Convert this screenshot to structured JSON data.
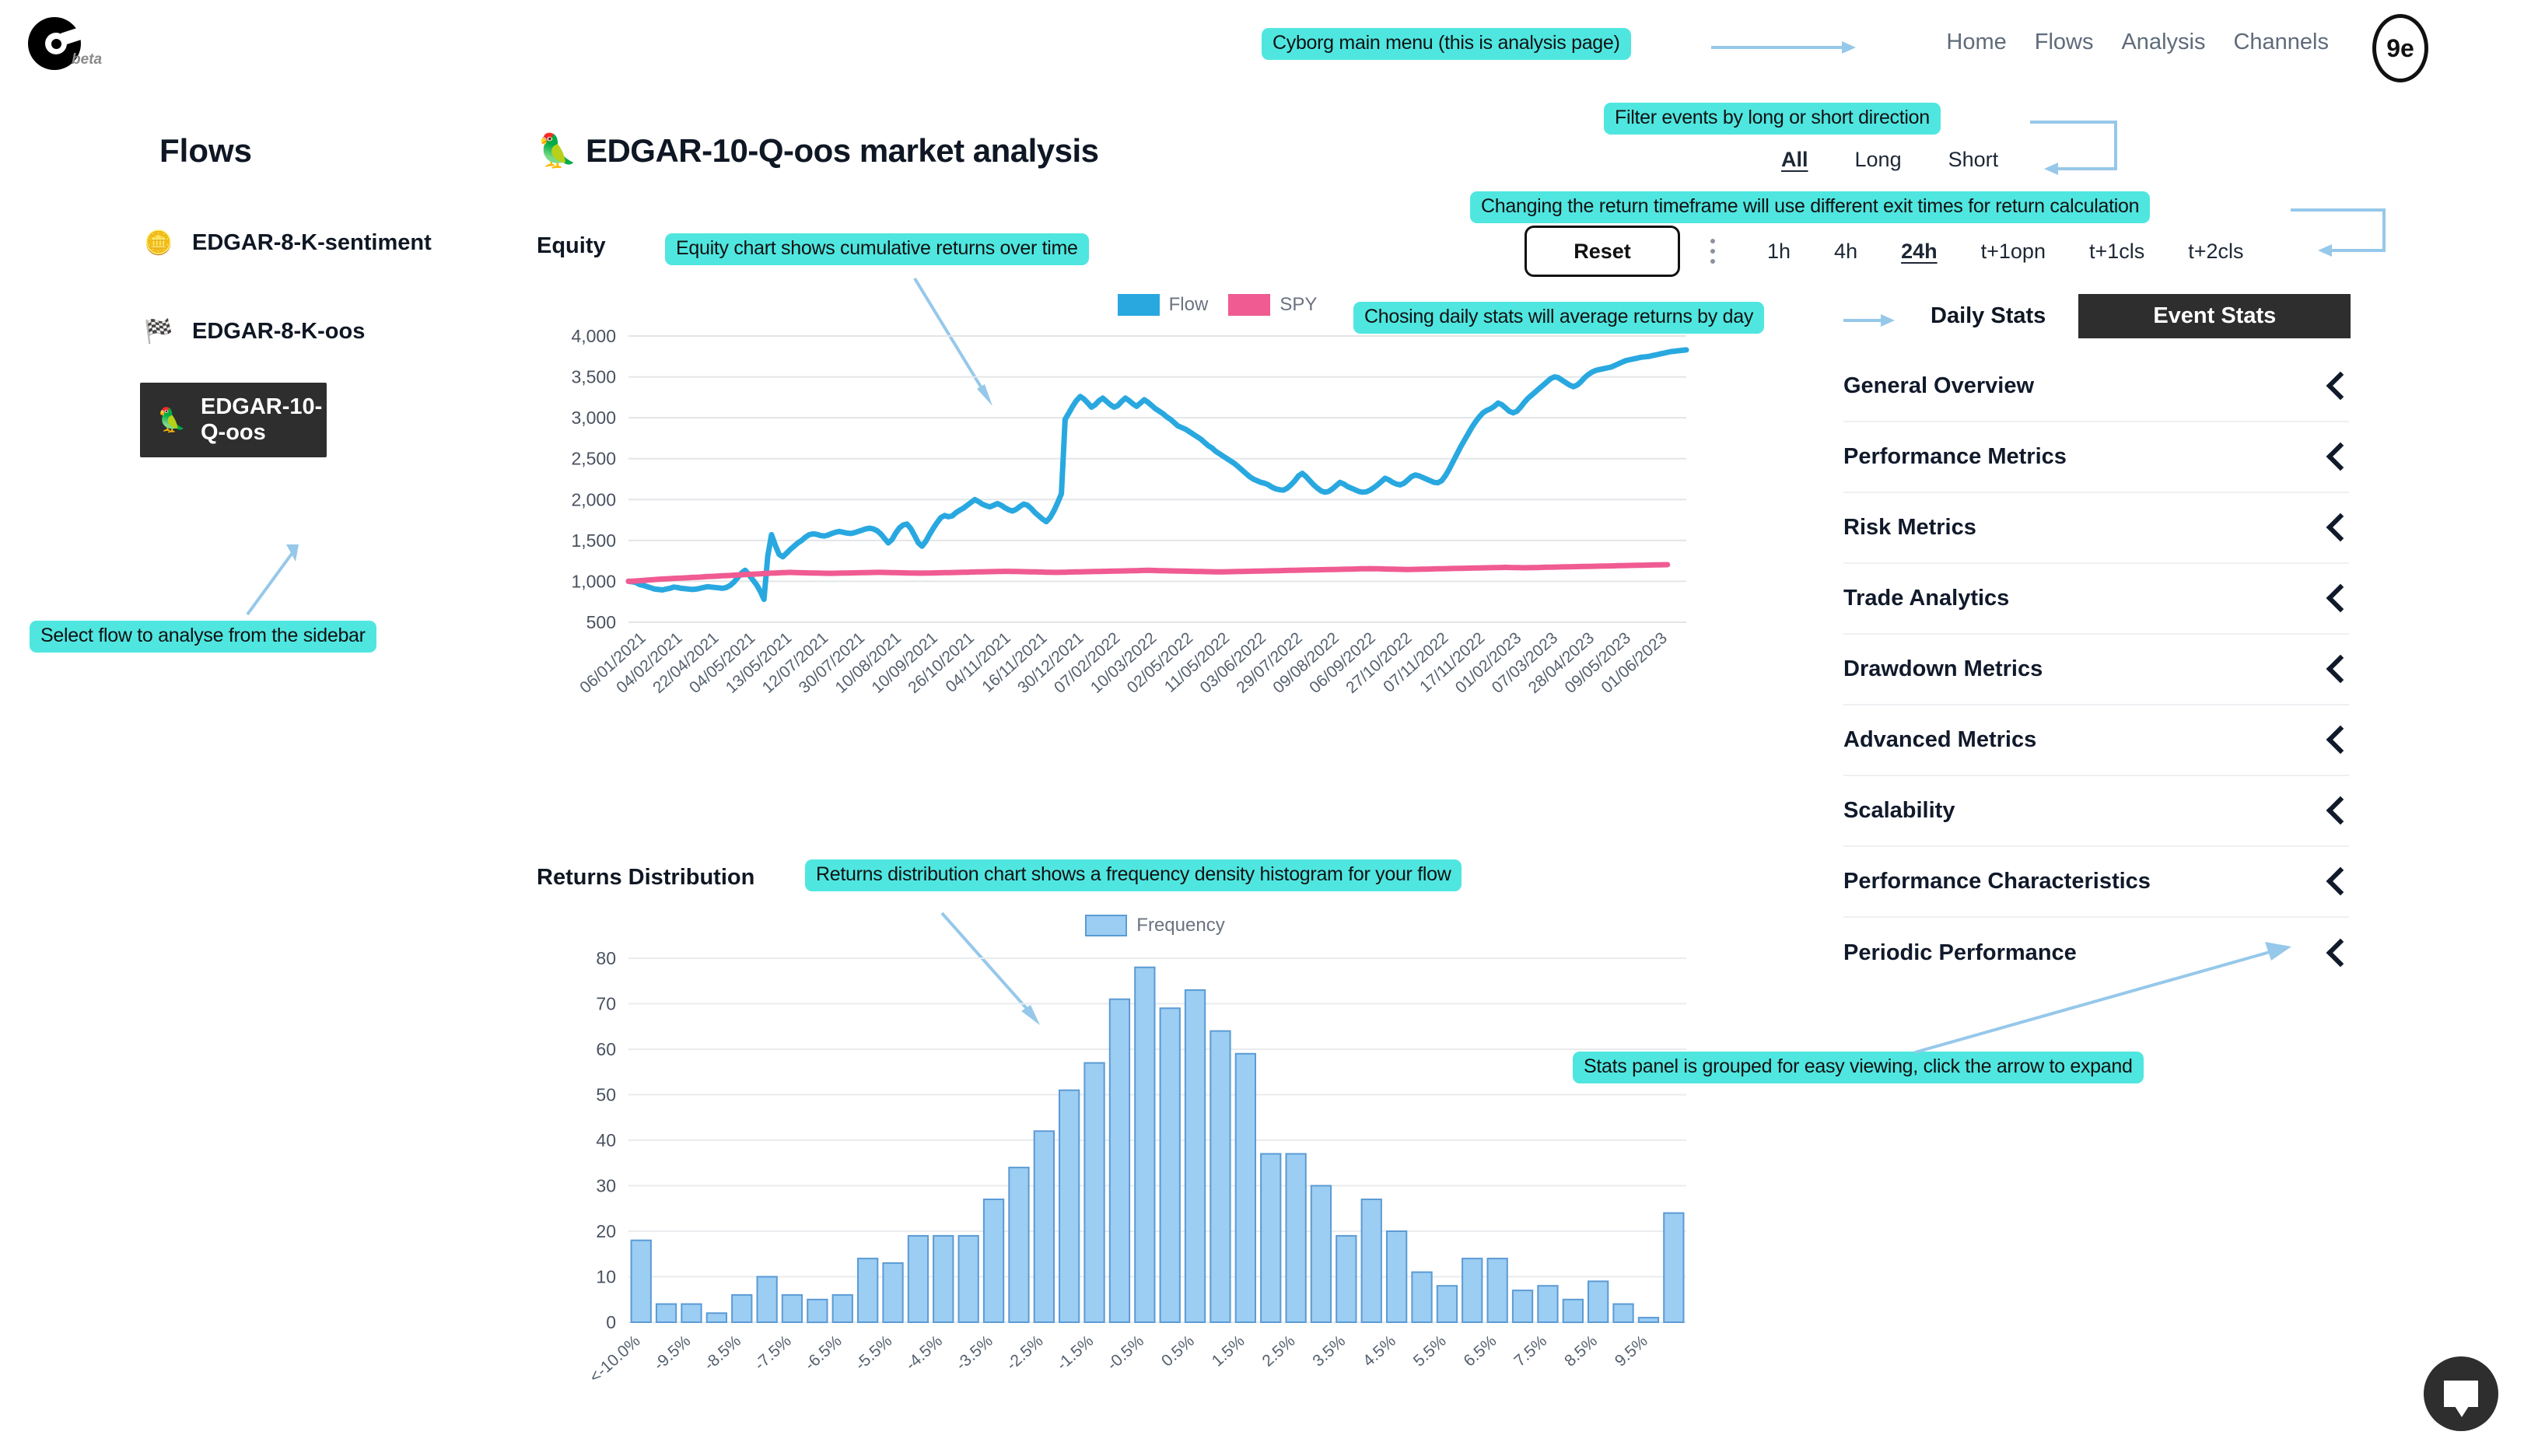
{
  "brand": {
    "logo_text": "beta",
    "badge_text": "9e"
  },
  "nav": {
    "items": [
      "Home",
      "Flows",
      "Analysis",
      "Channels"
    ]
  },
  "sidebar": {
    "title": "Flows",
    "items": [
      {
        "emoji": "🪙",
        "label": "EDGAR-8-K-sentiment",
        "active": false
      },
      {
        "emoji": "🏁",
        "label": "EDGAR-8-K-oos",
        "active": false
      },
      {
        "emoji": "🦜",
        "label": "EDGAR-10-Q-oos",
        "active": true
      }
    ]
  },
  "main": {
    "page_title": "🦜 EDGAR-10-Q-oos market analysis",
    "equity_label": "Equity",
    "returns_label": "Returns Distribution"
  },
  "controls": {
    "direction": {
      "options": [
        "All",
        "Long",
        "Short"
      ],
      "selected": "All"
    },
    "reset_label": "Reset",
    "kebab": "more-options",
    "timeframes": {
      "options": [
        "1h",
        "4h",
        "24h",
        "t+1opn",
        "t+1cls",
        "t+2cls"
      ],
      "selected": "24h"
    }
  },
  "stats": {
    "toggle": {
      "daily": "Daily Stats",
      "event": "Event Stats",
      "selected": "Event Stats"
    },
    "groups": [
      "General Overview",
      "Performance Metrics",
      "Risk Metrics",
      "Trade Analytics",
      "Drawdown Metrics",
      "Advanced Metrics",
      "Scalability",
      "Performance Characteristics",
      "Periodic Performance"
    ]
  },
  "annotations": [
    {
      "id": "menu",
      "text": "Cyborg main menu (this is analysis page)"
    },
    {
      "id": "filter",
      "text": "Filter events by long or short direction"
    },
    {
      "id": "timeframe",
      "text": "Changing the return timeframe will use different exit times for return calculation"
    },
    {
      "id": "equity",
      "text": "Equity chart shows cumulative returns over time"
    },
    {
      "id": "daily",
      "text": "Chosing daily stats will average returns by day"
    },
    {
      "id": "returns",
      "text": "Returns distribution chart shows a frequency density histogram for your flow"
    },
    {
      "id": "statspanel",
      "text": "Stats panel is grouped  for easy viewing, click the arrow to expand"
    },
    {
      "id": "select",
      "text": "Select flow to analyse from the sidebar"
    }
  ],
  "colors": {
    "accent_cyan": "#4fe6e0",
    "flow_blue": "#29a8e0",
    "spy_pink": "#f05b92",
    "hist_blue": "#9ccdf2",
    "dark": "#2e2e2e",
    "arrow_blue": "#96c8ea"
  },
  "chart_data": [
    {
      "type": "line",
      "title": "Equity",
      "xlabel": "",
      "ylabel": "",
      "ylim": [
        500,
        4000
      ],
      "yticks": [
        500,
        1000,
        1500,
        2000,
        2500,
        3000,
        3500,
        4000
      ],
      "grid": true,
      "legend_position": "top-center",
      "x_tick_labels": [
        "06/01/2021",
        "04/02/2021",
        "22/04/2021",
        "04/05/2021",
        "13/05/2021",
        "12/07/2021",
        "30/07/2021",
        "10/08/2021",
        "10/09/2021",
        "26/10/2021",
        "04/11/2021",
        "16/11/2021",
        "30/12/2021",
        "07/02/2022",
        "10/03/2022",
        "02/05/2022",
        "11/05/2022",
        "03/06/2022",
        "29/07/2022",
        "09/08/2022",
        "06/09/2022",
        "27/10/2022",
        "07/11/2022",
        "17/11/2022",
        "01/02/2023",
        "07/03/2023",
        "28/04/2023",
        "09/05/2023",
        "01/06/2023"
      ],
      "series": [
        {
          "name": "Flow",
          "color": "#29a8e0",
          "values": [
            1000,
            995,
            985,
            960,
            950,
            935,
            920,
            905,
            900,
            895,
            905,
            915,
            930,
            925,
            915,
            910,
            905,
            900,
            905,
            915,
            925,
            935,
            930,
            925,
            920,
            915,
            925,
            950,
            990,
            1045,
            1100,
            1135,
            1080,
            1020,
            960,
            880,
            780,
            1310,
            1570,
            1440,
            1330,
            1300,
            1345,
            1390,
            1430,
            1470,
            1500,
            1540,
            1570,
            1580,
            1575,
            1560,
            1555,
            1565,
            1585,
            1600,
            1610,
            1600,
            1590,
            1585,
            1595,
            1610,
            1625,
            1640,
            1650,
            1640,
            1620,
            1580,
            1525,
            1470,
            1510,
            1590,
            1655,
            1690,
            1700,
            1645,
            1560,
            1470,
            1430,
            1490,
            1575,
            1650,
            1720,
            1780,
            1805,
            1790,
            1800,
            1840,
            1870,
            1895,
            1930,
            1965,
            2000,
            1975,
            1945,
            1925,
            1910,
            1930,
            1950,
            1930,
            1900,
            1875,
            1860,
            1880,
            1915,
            1945,
            1930,
            1890,
            1840,
            1800,
            1760,
            1730,
            1780,
            1860,
            1960,
            2070,
            2980,
            3060,
            3140,
            3210,
            3260,
            3230,
            3180,
            3130,
            3160,
            3210,
            3240,
            3200,
            3160,
            3130,
            3150,
            3200,
            3240,
            3210,
            3170,
            3140,
            3180,
            3220,
            3190,
            3150,
            3110,
            3080,
            3050,
            3010,
            2980,
            2940,
            2900,
            2880,
            2860,
            2830,
            2800,
            2770,
            2740,
            2700,
            2660,
            2630,
            2590,
            2560,
            2530,
            2500,
            2470,
            2440,
            2400,
            2360,
            2320,
            2280,
            2250,
            2230,
            2210,
            2200,
            2180,
            2150,
            2130,
            2120,
            2115,
            2140,
            2180,
            2230,
            2290,
            2320,
            2280,
            2230,
            2180,
            2140,
            2105,
            2090,
            2100,
            2130,
            2170,
            2210,
            2190,
            2160,
            2140,
            2120,
            2100,
            2090,
            2095,
            2115,
            2145,
            2180,
            2220,
            2260,
            2240,
            2210,
            2190,
            2180,
            2200,
            2240,
            2280,
            2300,
            2290,
            2270,
            2250,
            2230,
            2210,
            2205,
            2230,
            2290,
            2370,
            2460,
            2550,
            2640,
            2720,
            2800,
            2880,
            2950,
            3010,
            3060,
            3090,
            3110,
            3140,
            3180,
            3160,
            3120,
            3080,
            3060,
            3080,
            3130,
            3190,
            3240,
            3280,
            3320,
            3360,
            3400,
            3440,
            3480,
            3500,
            3490,
            3460,
            3430,
            3400,
            3380,
            3400,
            3440,
            3490,
            3530,
            3560,
            3580,
            3590,
            3600,
            3610,
            3620,
            3640,
            3660,
            3680,
            3700,
            3710,
            3720,
            3730,
            3740,
            3745,
            3750,
            3760,
            3770,
            3780,
            3790,
            3800,
            3810,
            3815,
            3820,
            3825,
            3830
          ]
        },
        {
          "name": "SPY",
          "color": "#f05b92",
          "values": [
            1000,
            1002,
            1005,
            1008,
            1012,
            1015,
            1018,
            1022,
            1025,
            1028,
            1030,
            1033,
            1036,
            1038,
            1040,
            1042,
            1045,
            1048,
            1050,
            1052,
            1055,
            1058,
            1060,
            1062,
            1065,
            1068,
            1070,
            1072,
            1075,
            1078,
            1080,
            1083,
            1086,
            1088,
            1090,
            1092,
            1095,
            1098,
            1100,
            1102,
            1104,
            1106,
            1108,
            1110,
            1108,
            1106,
            1105,
            1104,
            1103,
            1102,
            1101,
            1100,
            1099,
            1098,
            1098,
            1099,
            1100,
            1101,
            1102,
            1103,
            1104,
            1105,
            1106,
            1107,
            1108,
            1109,
            1110,
            1110,
            1109,
            1108,
            1107,
            1106,
            1105,
            1104,
            1103,
            1102,
            1101,
            1100,
            1100,
            1101,
            1102,
            1103,
            1104,
            1105,
            1106,
            1107,
            1108,
            1109,
            1110,
            1111,
            1112,
            1113,
            1114,
            1115,
            1116,
            1117,
            1118,
            1119,
            1120,
            1121,
            1122,
            1122,
            1121,
            1120,
            1119,
            1118,
            1117,
            1116,
            1115,
            1114,
            1113,
            1112,
            1111,
            1110,
            1110,
            1111,
            1112,
            1113,
            1114,
            1115,
            1116,
            1117,
            1118,
            1119,
            1120,
            1121,
            1122,
            1123,
            1124,
            1125,
            1126,
            1127,
            1128,
            1129,
            1130,
            1131,
            1132,
            1133,
            1134,
            1133,
            1132,
            1131,
            1130,
            1129,
            1128,
            1127,
            1126,
            1125,
            1124,
            1123,
            1122,
            1121,
            1120,
            1119,
            1118,
            1117,
            1116,
            1115,
            1116,
            1117,
            1118,
            1119,
            1120,
            1121,
            1122,
            1123,
            1124,
            1125,
            1126,
            1127,
            1128,
            1129,
            1130,
            1131,
            1132,
            1133,
            1134,
            1135,
            1136,
            1137,
            1138,
            1139,
            1140,
            1141,
            1142,
            1143,
            1144,
            1145,
            1146,
            1147,
            1148,
            1149,
            1150,
            1151,
            1152,
            1153,
            1154,
            1155,
            1154,
            1153,
            1152,
            1151,
            1150,
            1149,
            1148,
            1147,
            1146,
            1145,
            1146,
            1147,
            1148,
            1149,
            1150,
            1151,
            1152,
            1153,
            1154,
            1155,
            1156,
            1157,
            1158,
            1159,
            1160,
            1161,
            1162,
            1163,
            1164,
            1165,
            1166,
            1167,
            1168,
            1169,
            1170,
            1171,
            1170,
            1169,
            1168,
            1167,
            1166,
            1167,
            1168,
            1169,
            1170,
            1171,
            1172,
            1173,
            1174,
            1175,
            1176,
            1177,
            1178,
            1179,
            1180,
            1181,
            1182,
            1183,
            1184,
            1185,
            1186,
            1187,
            1188,
            1189,
            1190,
            1191,
            1192,
            1193,
            1194,
            1195,
            1196,
            1197,
            1198,
            1199,
            1200,
            1201,
            1202,
            1203,
            1204
          ]
        }
      ]
    },
    {
      "type": "bar",
      "title": "Returns Distribution",
      "xlabel": "",
      "ylabel": "",
      "ylim": [
        0,
        80
      ],
      "yticks": [
        0,
        10,
        20,
        30,
        40,
        50,
        60,
        70,
        80
      ],
      "grid": true,
      "legend_position": "top-center",
      "legend_entries": [
        "Frequency"
      ],
      "categories": [
        "<-10.0%",
        "",
        "-9.5%",
        "",
        "-8.5%",
        "",
        "-7.5%",
        "",
        "-6.5%",
        "",
        "-5.5%",
        "",
        "-4.5%",
        "",
        "-3.5%",
        "",
        "-2.5%",
        "",
        "-1.5%",
        "",
        "-0.5%",
        "",
        "0.5%",
        "",
        "1.5%",
        "",
        "2.5%",
        "",
        "3.5%",
        "",
        "4.5%",
        "",
        "5.5%",
        "",
        "6.5%",
        "",
        "7.5%",
        "",
        "8.5%",
        "",
        "9.5%",
        ""
      ],
      "tick_labels": [
        "<-10.0%",
        "-9.5%",
        "-8.5%",
        "-7.5%",
        "-6.5%",
        "-5.5%",
        "-4.5%",
        "-3.5%",
        "-2.5%",
        "-1.5%",
        "-0.5%",
        "0.5%",
        "1.5%",
        "2.5%",
        "3.5%",
        "4.5%",
        "5.5%",
        "6.5%",
        "7.5%",
        "8.5%",
        "9.5%"
      ],
      "values": [
        18,
        4,
        4,
        2,
        6,
        10,
        6,
        5,
        6,
        14,
        13,
        19,
        19,
        19,
        27,
        34,
        42,
        51,
        57,
        71,
        78,
        69,
        73,
        64,
        59,
        37,
        37,
        30,
        19,
        27,
        20,
        11,
        8,
        14,
        14,
        7,
        8,
        5,
        9,
        4,
        1,
        24
      ]
    }
  ]
}
